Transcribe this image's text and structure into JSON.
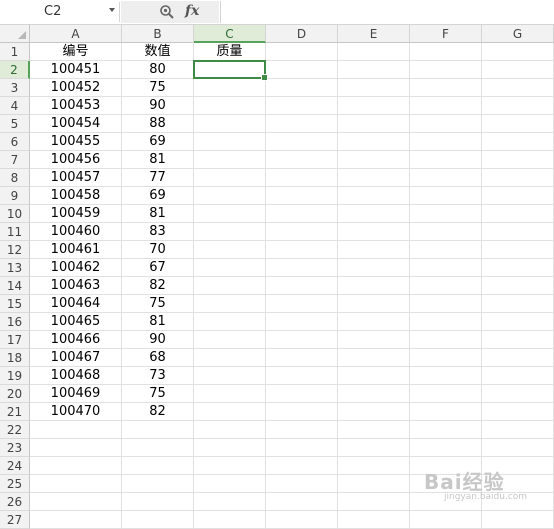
{
  "name_box": {
    "value": "C2"
  },
  "formula_bar": {
    "fx_label": "fx",
    "value": ""
  },
  "columns": [
    "A",
    "B",
    "C",
    "D",
    "E",
    "F",
    "G"
  ],
  "active_cell": {
    "col": "C",
    "row": 2
  },
  "rows": [
    [
      "1",
      "编号",
      "数值",
      "质量"
    ],
    [
      "2",
      "100451",
      "80",
      ""
    ],
    [
      "3",
      "100452",
      "75",
      ""
    ],
    [
      "4",
      "100453",
      "90",
      ""
    ],
    [
      "5",
      "100454",
      "88",
      ""
    ],
    [
      "6",
      "100455",
      "69",
      ""
    ],
    [
      "7",
      "100456",
      "81",
      ""
    ],
    [
      "8",
      "100457",
      "77",
      ""
    ],
    [
      "9",
      "100458",
      "69",
      ""
    ],
    [
      "10",
      "100459",
      "81",
      ""
    ],
    [
      "11",
      "100460",
      "83",
      ""
    ],
    [
      "12",
      "100461",
      "70",
      ""
    ],
    [
      "13",
      "100462",
      "67",
      ""
    ],
    [
      "14",
      "100463",
      "82",
      ""
    ],
    [
      "15",
      "100464",
      "75",
      ""
    ],
    [
      "16",
      "100465",
      "81",
      ""
    ],
    [
      "17",
      "100466",
      "90",
      ""
    ],
    [
      "18",
      "100467",
      "68",
      ""
    ],
    [
      "19",
      "100468",
      "73",
      ""
    ],
    [
      "20",
      "100469",
      "75",
      ""
    ],
    [
      "21",
      "100470",
      "82",
      ""
    ],
    [
      "22",
      "",
      "",
      ""
    ],
    [
      "23",
      "",
      "",
      ""
    ],
    [
      "24",
      "",
      "",
      ""
    ],
    [
      "25",
      "",
      "",
      ""
    ],
    [
      "26",
      "",
      "",
      ""
    ],
    [
      "27",
      "",
      "",
      ""
    ]
  ],
  "watermark": {
    "line1": "Bai经验",
    "line2": "jingyan.baidu.com"
  },
  "colors": {
    "selection": "#3f8b46",
    "header_active": "#e0ecd8",
    "header_bg": "#f2f2f2"
  },
  "icons": {
    "zoom": "zoom-icon",
    "dropdown": "chevron-down-icon"
  }
}
